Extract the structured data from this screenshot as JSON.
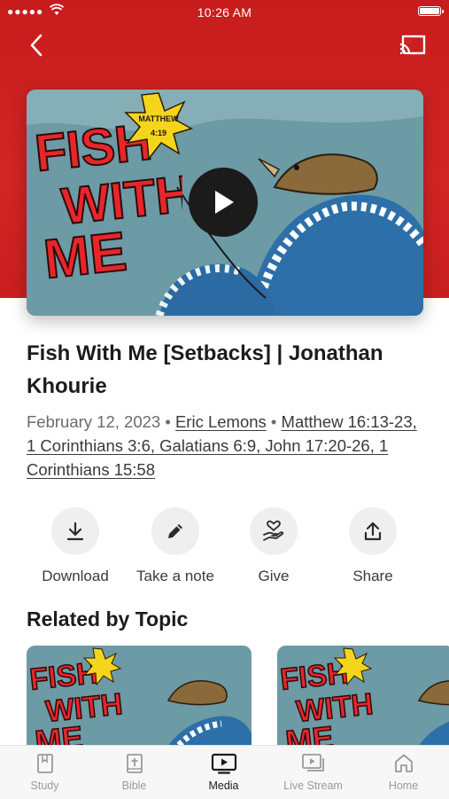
{
  "status": {
    "time": "10:26 AM"
  },
  "header": {
    "back_icon": "chevron-left-icon",
    "cast_icon": "cast-icon"
  },
  "media": {
    "art_text": [
      "FISH",
      "WITH",
      "ME"
    ],
    "badge_text": [
      "MATTHEW",
      "4:19"
    ],
    "title": "Fish With Me [Setbacks] | Jonathan Khourie",
    "date": "February 12, 2023",
    "speaker": "Eric Lemons",
    "scripture": "Matthew 16:13-23, 1 Corinthians 3:6, Galatians 6:9, John 17:20-26, 1 Corinthians 15:58",
    "separator": "•"
  },
  "actions": [
    {
      "label": "Download",
      "icon": "download-icon"
    },
    {
      "label": "Take a note",
      "icon": "pencil-icon"
    },
    {
      "label": "Give",
      "icon": "give-heart-icon"
    },
    {
      "label": "Share",
      "icon": "share-icon"
    }
  ],
  "related": {
    "title": "Related by Topic"
  },
  "tabs": [
    {
      "label": "Study",
      "icon": "book-icon",
      "active": false
    },
    {
      "label": "Bible",
      "icon": "bible-icon",
      "active": false
    },
    {
      "label": "Media",
      "icon": "tv-play-icon",
      "active": true
    },
    {
      "label": "Live Stream",
      "icon": "live-stream-icon",
      "active": false
    },
    {
      "label": "Home",
      "icon": "home-icon",
      "active": false
    }
  ],
  "colors": {
    "brand_red": "#d22424",
    "active_tab": "#1c1c1c",
    "inactive_tab": "#9a9a9a"
  }
}
